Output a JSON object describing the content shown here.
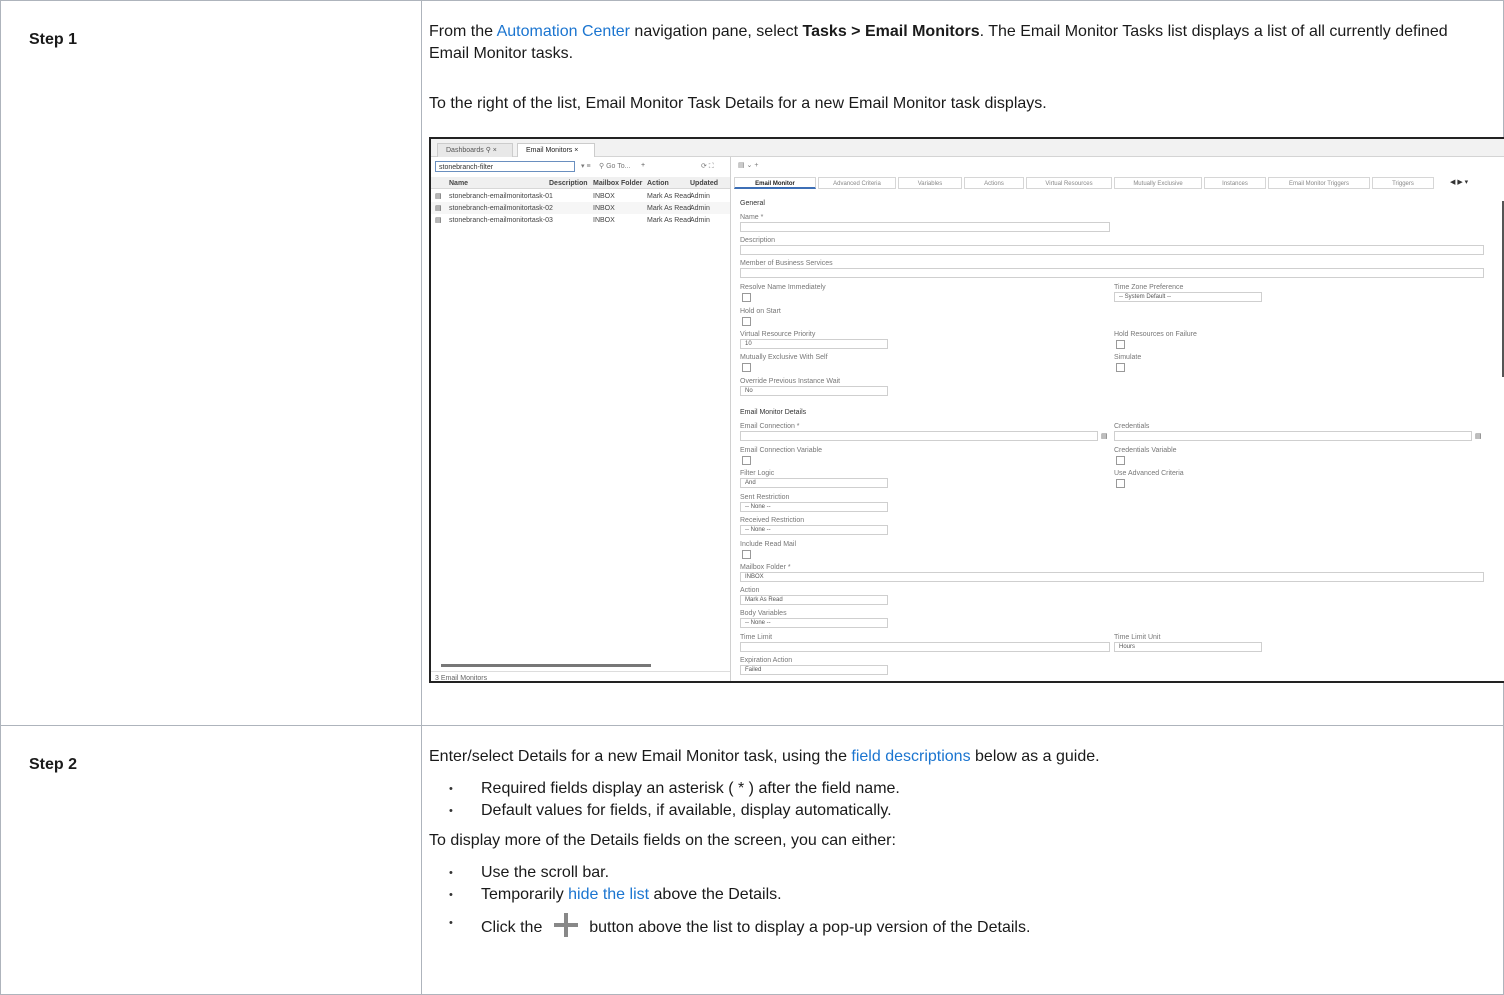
{
  "step1": {
    "label": "Step 1",
    "p1_pre": "From the ",
    "p1_link": "Automation Center",
    "p1_mid": " navigation pane, select ",
    "p1_bold": "Tasks > Email Monitors",
    "p1_post": ". The Email Monitor Tasks list displays a list of all currently defined Email Monitor tasks.",
    "p2": "To the right of the list, Email Monitor Task Details for a new Email Monitor task displays."
  },
  "screenshot": {
    "tabs": [
      "Dashboards ⚲ ×",
      "Email Monitors ×"
    ],
    "filter_value": "stonebranch-filter",
    "goto_label": "Go To...",
    "columns": [
      "Name",
      "Description",
      "Mailbox Folder",
      "Action",
      "Updated"
    ],
    "rows": [
      {
        "name": "stonebranch-emailmonitortask-01",
        "folder": "INBOX",
        "action": "Mark As Read",
        "updated": "Admin"
      },
      {
        "name": "stonebranch-emailmonitortask-02",
        "folder": "INBOX",
        "action": "Mark As Read",
        "updated": "Admin"
      },
      {
        "name": "stonebranch-emailmonitortask-03",
        "folder": "INBOX",
        "action": "Mark As Read",
        "updated": "Admin"
      }
    ],
    "footer": "3 Email Monitors",
    "detail_tabs": [
      "Email Monitor",
      "Advanced Criteria",
      "Variables",
      "Actions",
      "Virtual Resources",
      "Mutually Exclusive",
      "Instances",
      "Email Monitor Triggers",
      "Triggers"
    ],
    "general": "General",
    "name_lbl": "Name *",
    "desc_lbl": "Description",
    "member_lbl": "Member of Business Services",
    "resolve_lbl": "Resolve Name Immediately",
    "tz_lbl": "Time Zone Preference",
    "tz_val": "-- System Default --",
    "hold_lbl": "Hold on Start",
    "vrp_lbl": "Virtual Resource Priority",
    "vrp_val": "10",
    "hrf_lbl": "Hold Resources on Failure",
    "mews_lbl": "Mutually Exclusive With Self",
    "sim_lbl": "Simulate",
    "opiw_lbl": "Override Previous Instance Wait",
    "opiw_val": "No",
    "emd": "Email Monitor Details",
    "ec_lbl": "Email Connection *",
    "cred_lbl": "Credentials",
    "ecv_lbl": "Email Connection Variable",
    "cv_lbl": "Credentials Variable",
    "fl_lbl": "Filter Logic",
    "fl_val": "And",
    "uac_lbl": "Use Advanced Criteria",
    "sr_lbl": "Sent Restriction",
    "sr_val": "-- None --",
    "rr_lbl": "Received Restriction",
    "rr_val": "-- None --",
    "irm_lbl": "Include Read Mail",
    "mf_lbl": "Mailbox Folder *",
    "mf_val": "INBOX",
    "act_lbl": "Action",
    "act_val": "Mark As Read",
    "bv_lbl": "Body Variables",
    "bv_val": "-- None --",
    "tl_lbl": "Time Limit",
    "tlu_lbl": "Time Limit Unit",
    "tlu_val": "Hours",
    "ea_lbl": "Expiration Action",
    "ea_val": "Failed"
  },
  "step2": {
    "label": "Step 2",
    "p1_pre": "Enter/select Details for a new Email Monitor task, using the ",
    "p1_link": "field descriptions",
    "p1_post": " below as a guide.",
    "b1": "Required fields display an asterisk ( * ) after the field name.",
    "b2": "Default values for fields, if available, display automatically.",
    "p2": "To display more of the Details fields on the screen, you can either:",
    "b3": "Use the scroll bar.",
    "b4_pre": "Temporarily ",
    "b4_link": "hide the list",
    "b4_post": " above the Details.",
    "b5_pre": "Click the ",
    "b5_post": " button above the list to display a pop-up version of the Details."
  }
}
